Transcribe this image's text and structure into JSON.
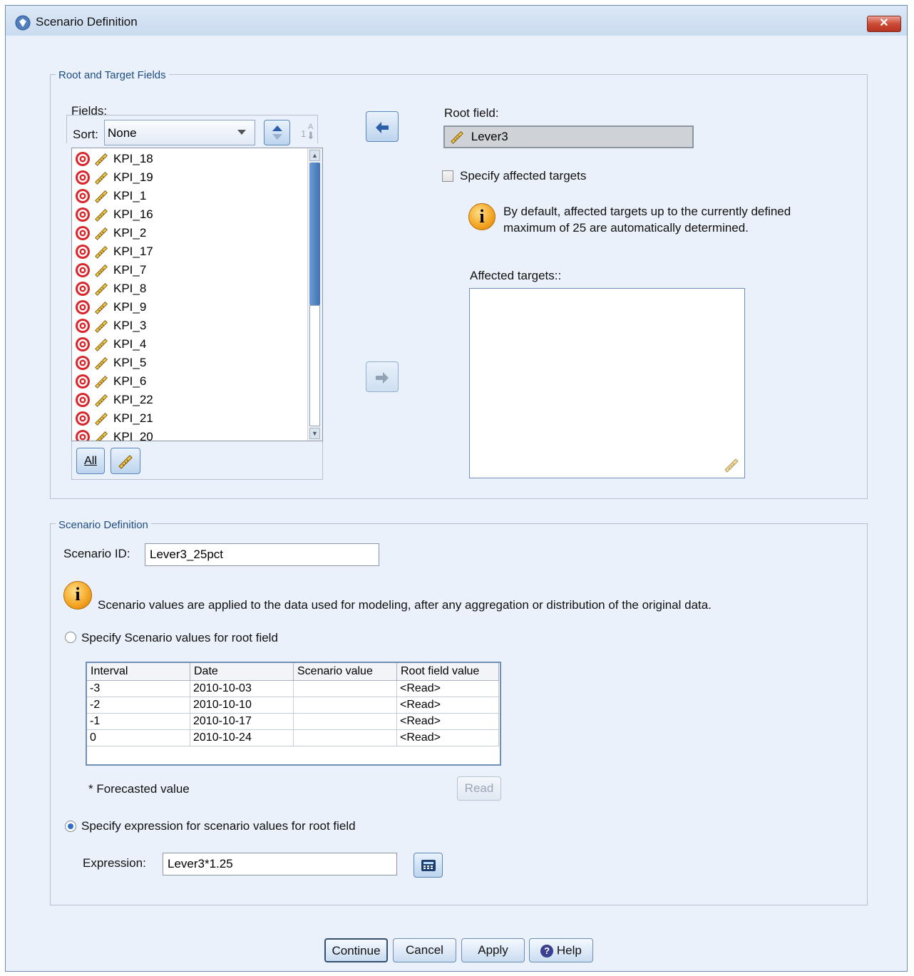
{
  "window": {
    "title": "Scenario Definition",
    "close_label": "✕"
  },
  "root_target": {
    "legend": "Root and Target Fields",
    "fields_label": "Fields:",
    "sort_label": "Sort:",
    "sort_value": "None",
    "fields": [
      "KPI_18",
      "KPI_19",
      "KPI_1",
      "KPI_16",
      "KPI_2",
      "KPI_17",
      "KPI_7",
      "KPI_8",
      "KPI_9",
      "KPI_3",
      "KPI_4",
      "KPI_5",
      "KPI_6",
      "KPI_22",
      "KPI_21",
      "KPI_20"
    ],
    "all_button": "All",
    "root_field_label": "Root field:",
    "root_field_value": "Lever3",
    "specify_targets_label": "Specify affected targets",
    "info_text_line1": "By default, affected targets up to the currently defined",
    "info_text_line2": "maximum of 25 are automatically determined.",
    "affected_targets_label": "Affected targets::"
  },
  "scenario": {
    "legend": "Scenario Definition",
    "id_label": "Scenario ID:",
    "id_value": "Lever3_25pct",
    "info_text": "Scenario values are applied to the data used for modeling, after any aggregation or distribution of the original data.",
    "radio_values_label": "Specify Scenario values for root field",
    "table": {
      "headers": [
        "Interval",
        "Date",
        "Scenario value",
        "Root field value"
      ],
      "rows": [
        [
          "-3",
          "2010-10-03",
          "",
          "<Read>"
        ],
        [
          "-2",
          "2010-10-10",
          "",
          "<Read>"
        ],
        [
          "-1",
          "2010-10-17",
          "",
          "<Read>"
        ],
        [
          "0",
          "2010-10-24",
          "",
          "<Read>"
        ]
      ]
    },
    "forecasted_note": "* Forecasted value",
    "read_button": "Read",
    "radio_expression_label": "Specify expression for scenario values for root field",
    "expression_label": "Expression:",
    "expression_value": "Lever3*1.25"
  },
  "buttons": {
    "continue": "Continue",
    "cancel": "Cancel",
    "apply": "Apply",
    "help": "Help"
  },
  "colors": {
    "accent": "#2d6fc4",
    "legend": "#1e4d86",
    "target_red": "#d9262b"
  }
}
